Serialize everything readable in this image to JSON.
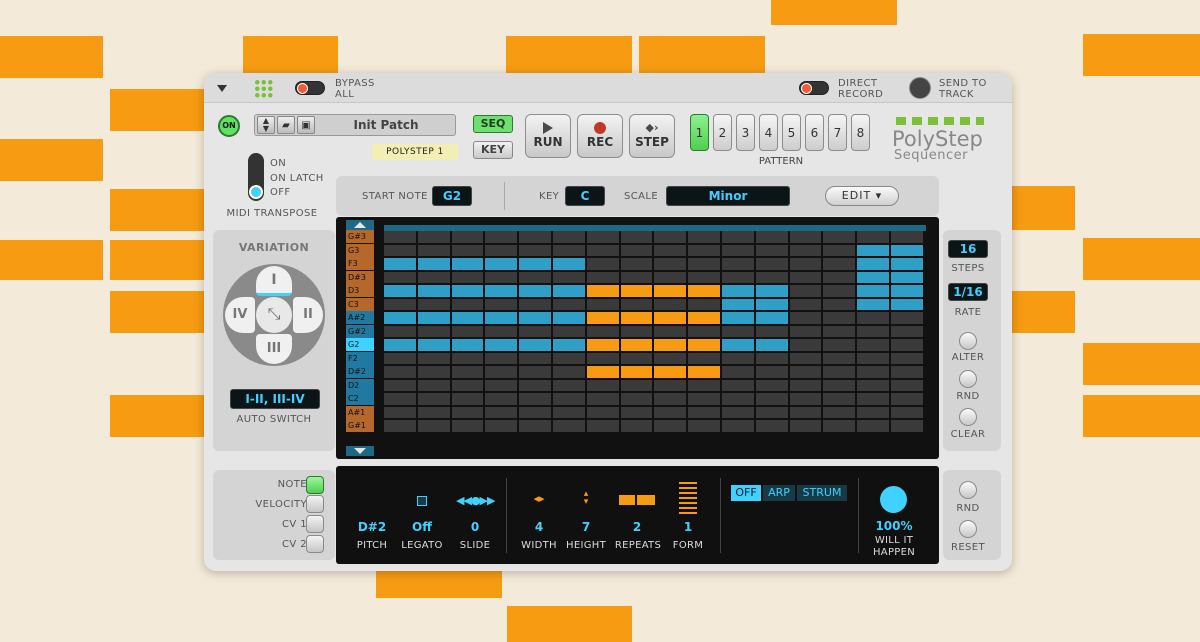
{
  "topbar": {
    "bypass_label": "BYPASS ALL",
    "direct_record_label": "DIRECT RECORD",
    "send_to_track_label": "SEND TO TRACK"
  },
  "header": {
    "on_label": "ON",
    "patch_name": "Init Patch",
    "device_tag": "POLYSTEP 1",
    "seq_label": "SEQ",
    "key_label": "KEY",
    "run_label": "RUN",
    "rec_label": "REC",
    "step_label": "STEP",
    "pattern_label": "PATTERN",
    "patterns": [
      "1",
      "2",
      "3",
      "4",
      "5",
      "6",
      "7",
      "8"
    ],
    "selected_pattern": "1",
    "brand_title": "PolyStep",
    "brand_subtitle": "Sequencer"
  },
  "midi_transpose": {
    "options": [
      "ON",
      "ON LATCH",
      "OFF"
    ],
    "selected": "OFF",
    "label": "MIDI TRANSPOSE"
  },
  "scale_bar": {
    "start_note_label": "START NOTE",
    "start_note_value": "G2",
    "key_label": "KEY",
    "key_value": "C",
    "scale_label": "SCALE",
    "scale_value": "Minor",
    "edit_label": "EDIT"
  },
  "variation": {
    "title": "VARIATION",
    "top": "I",
    "right": "II",
    "bottom": "III",
    "left": "IV",
    "auto_switch_value": "I-II, III-IV",
    "auto_switch_label": "AUTO SWITCH"
  },
  "grid": {
    "notes": [
      "G#3",
      "G3",
      "F3",
      "D#3",
      "D3",
      "C3",
      "A#2",
      "G#2",
      "G2",
      "F2",
      "D#2",
      "D2",
      "C2",
      "A#1",
      "G#1"
    ],
    "highlighted_note": "G2",
    "steps": 16
  },
  "right_panel": {
    "steps_value": "16",
    "steps_label": "STEPS",
    "rate_value": "1/16",
    "rate_label": "RATE",
    "alter_label": "ALTER",
    "rnd_label": "RND",
    "clear_label": "CLEAR",
    "rnd2_label": "RND",
    "reset_label": "RESET"
  },
  "lane_select": {
    "items": [
      "NOTE",
      "VELOCITY",
      "CV 1",
      "CV 2"
    ],
    "selected": "NOTE"
  },
  "note_props": {
    "pitch_value": "D#2",
    "pitch_label": "PITCH",
    "legato_value": "Off",
    "legato_label": "LEGATO",
    "slide_value": "0",
    "slide_label": "SLIDE",
    "width_value": "4",
    "width_label": "WIDTH",
    "height_value": "7",
    "height_label": "HEIGHT",
    "repeats_value": "2",
    "repeats_label": "REPEATS",
    "form_value": "1",
    "form_label": "FORM",
    "mode_options": [
      "OFF",
      "ARP",
      "STRUM"
    ],
    "mode_selected": "OFF",
    "chance_value": "100%",
    "chance_label_1": "WILL IT",
    "chance_label_2": "HAPPEN"
  },
  "colors": {
    "accent_orange": "#f79c12",
    "note_blue": "#2f9fc7",
    "lcd_text": "#3fd1ff",
    "led_green": "#5fe35f"
  }
}
